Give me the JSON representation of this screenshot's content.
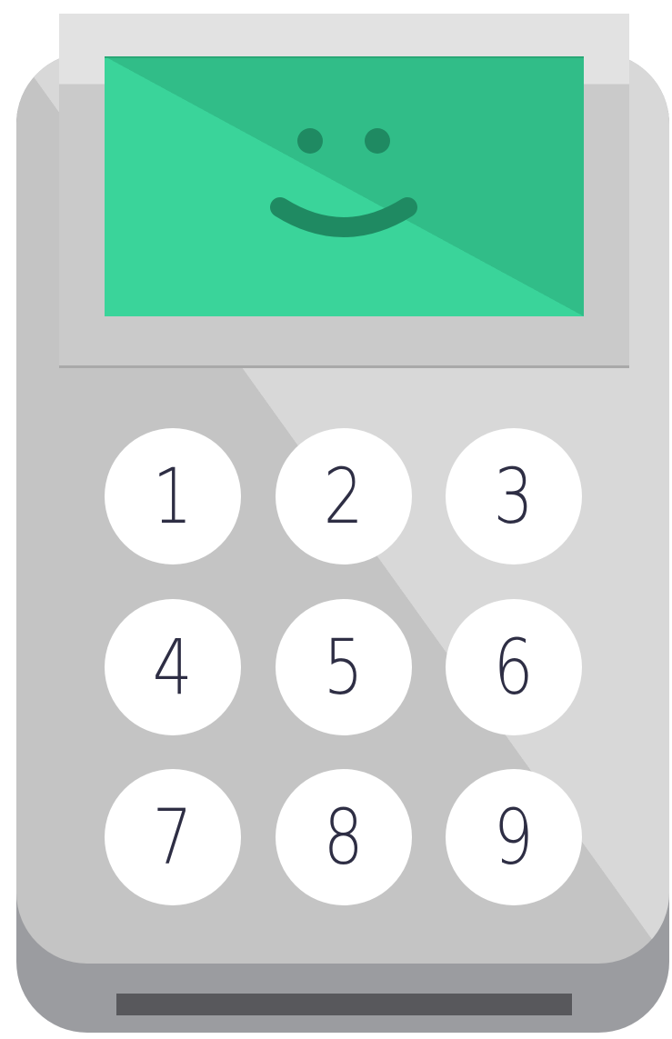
{
  "device": {
    "screen": {
      "face_icon": "smiley-face-icon",
      "color": "#3ad49a"
    },
    "keypad": {
      "keys": [
        "1",
        "2",
        "3",
        "4",
        "5",
        "6",
        "7",
        "8",
        "9"
      ]
    },
    "card_slot": "card-slot"
  }
}
